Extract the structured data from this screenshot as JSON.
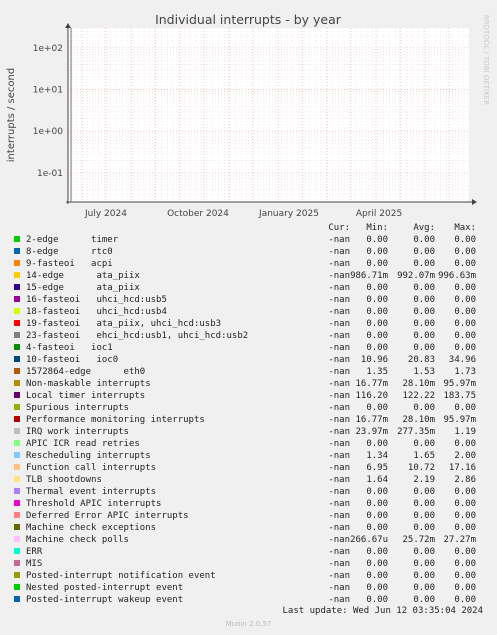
{
  "chart_data": {
    "type": "line",
    "title": "Individual interrupts - by year",
    "ylabel": "interrupts / second",
    "yscale": "log",
    "ylim": [
      0.02,
      300
    ],
    "y_ticks": [
      "1e+02",
      "1e+01",
      "1e+00",
      "1e-01"
    ],
    "x_ticks": [
      "July 2024",
      "October 2024",
      "January 2025",
      "April 2025"
    ],
    "grid": true,
    "legend_placement": "below",
    "series": []
  },
  "watermark": "RRDTOOL / TOBI OETIKER",
  "legend": {
    "headers": {
      "cur": "Cur:",
      "min": "Min:",
      "avg": "Avg:",
      "max": "Max:"
    },
    "rows": [
      {
        "name": "2-edge      timer",
        "color": "#00cc00",
        "cur": "-nan",
        "min": "0.00",
        "avg": "0.00",
        "max": "0.00"
      },
      {
        "name": "8-edge      rtc0",
        "color": "#0066b3",
        "cur": "-nan",
        "min": "0.00",
        "avg": "0.00",
        "max": "0.00"
      },
      {
        "name": "9-fasteoi   acpi",
        "color": "#ff8000",
        "cur": "-nan",
        "min": "0.00",
        "avg": "0.00",
        "max": "0.00"
      },
      {
        "name": "14-edge      ata_piix",
        "color": "#ffcc00",
        "cur": "-nan",
        "min": "986.71m",
        "avg": "992.07m",
        "max": "996.63m"
      },
      {
        "name": "15-edge      ata_piix",
        "color": "#330099",
        "cur": "-nan",
        "min": "0.00",
        "avg": "0.00",
        "max": "0.00"
      },
      {
        "name": "16-fasteoi   uhci_hcd:usb5",
        "color": "#990099",
        "cur": "-nan",
        "min": "0.00",
        "avg": "0.00",
        "max": "0.00"
      },
      {
        "name": "18-fasteoi   uhci_hcd:usb4",
        "color": "#ccff00",
        "cur": "-nan",
        "min": "0.00",
        "avg": "0.00",
        "max": "0.00"
      },
      {
        "name": "19-fasteoi   ata_piix, uhci_hcd:usb3",
        "color": "#ff0000",
        "cur": "-nan",
        "min": "0.00",
        "avg": "0.00",
        "max": "0.00"
      },
      {
        "name": "23-fasteoi   ehci_hcd:usb1, uhci_hcd:usb2",
        "color": "#808080",
        "cur": "-nan",
        "min": "0.00",
        "avg": "0.00",
        "max": "0.00"
      },
      {
        "name": "4-fasteoi   ioc1",
        "color": "#008f00",
        "cur": "-nan",
        "min": "0.00",
        "avg": "0.00",
        "max": "0.00"
      },
      {
        "name": "10-fasteoi   ioc0",
        "color": "#00487d",
        "cur": "-nan",
        "min": "10.96",
        "avg": "20.83",
        "max": "34.96"
      },
      {
        "name": "1572864-edge      eth0",
        "color": "#b35a00",
        "cur": "-nan",
        "min": "1.35",
        "avg": "1.53",
        "max": "1.73"
      },
      {
        "name": "Non-maskable interrupts",
        "color": "#b38f00",
        "cur": "-nan",
        "min": "16.77m",
        "avg": "28.10m",
        "max": "95.97m"
      },
      {
        "name": "Local timer interrupts",
        "color": "#6b006b",
        "cur": "-nan",
        "min": "116.20",
        "avg": "122.22",
        "max": "183.75"
      },
      {
        "name": "Spurious interrupts",
        "color": "#8fb300",
        "cur": "-nan",
        "min": "0.00",
        "avg": "0.00",
        "max": "0.00"
      },
      {
        "name": "Performance monitoring interrupts",
        "color": "#b30000",
        "cur": "-nan",
        "min": "16.77m",
        "avg": "28.10m",
        "max": "95.97m"
      },
      {
        "name": "IRQ work interrupts",
        "color": "#bebebe",
        "cur": "-nan",
        "min": "23.97m",
        "avg": "277.35m",
        "max": "1.19"
      },
      {
        "name": "APIC ICR read retries",
        "color": "#80ff80",
        "cur": "-nan",
        "min": "0.00",
        "avg": "0.00",
        "max": "0.00"
      },
      {
        "name": "Rescheduling interrupts",
        "color": "#80c9ff",
        "cur": "-nan",
        "min": "1.34",
        "avg": "1.65",
        "max": "2.00"
      },
      {
        "name": "Function call interrupts",
        "color": "#ffc080",
        "cur": "-nan",
        "min": "6.95",
        "avg": "10.72",
        "max": "17.16"
      },
      {
        "name": "TLB shootdowns",
        "color": "#ffe680",
        "cur": "-nan",
        "min": "1.64",
        "avg": "2.19",
        "max": "2.86"
      },
      {
        "name": "Thermal event interrupts",
        "color": "#aa80ff",
        "cur": "-nan",
        "min": "0.00",
        "avg": "0.00",
        "max": "0.00"
      },
      {
        "name": "Threshold APIC interrupts",
        "color": "#ee00cc",
        "cur": "-nan",
        "min": "0.00",
        "avg": "0.00",
        "max": "0.00"
      },
      {
        "name": "Deferred Error APIC interrupts",
        "color": "#ff8080",
        "cur": "-nan",
        "min": "0.00",
        "avg": "0.00",
        "max": "0.00"
      },
      {
        "name": "Machine check exceptions",
        "color": "#666600",
        "cur": "-nan",
        "min": "0.00",
        "avg": "0.00",
        "max": "0.00"
      },
      {
        "name": "Machine check polls",
        "color": "#ffbfff",
        "cur": "-nan",
        "min": "266.67u",
        "avg": "25.72m",
        "max": "27.27m"
      },
      {
        "name": "ERR",
        "color": "#00ffcc",
        "cur": "-nan",
        "min": "0.00",
        "avg": "0.00",
        "max": "0.00"
      },
      {
        "name": "MIS",
        "color": "#cc6699",
        "cur": "-nan",
        "min": "0.00",
        "avg": "0.00",
        "max": "0.00"
      },
      {
        "name": "Posted-interrupt notification event",
        "color": "#999900",
        "cur": "-nan",
        "min": "0.00",
        "avg": "0.00",
        "max": "0.00"
      },
      {
        "name": "Nested posted-interrupt event",
        "color": "#00cc00",
        "cur": "-nan",
        "min": "0.00",
        "avg": "0.00",
        "max": "0.00"
      },
      {
        "name": "Posted-interrupt wakeup event",
        "color": "#0066b3",
        "cur": "-nan",
        "min": "0.00",
        "avg": "0.00",
        "max": "0.00"
      }
    ]
  },
  "last_update": "Last update: Wed Jun 12 03:35:04 2024",
  "footer": "Munin 2.0.57"
}
